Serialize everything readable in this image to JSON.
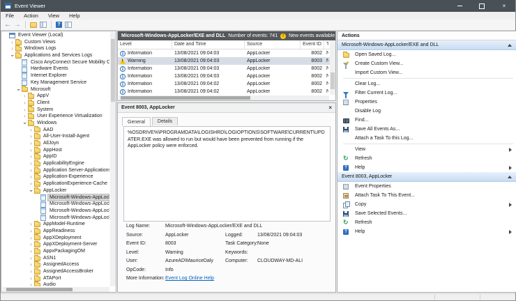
{
  "window": {
    "title": "Event Viewer"
  },
  "menu": [
    "File",
    "Action",
    "View",
    "Help"
  ],
  "toolbar": {
    "icons": [
      "back",
      "forward",
      "up-folder",
      "show-console-tree",
      "help",
      "show-action-pane"
    ]
  },
  "tree": {
    "items": [
      {
        "label": "Event Viewer (Local)",
        "level": 0,
        "chev": "none",
        "icon": "root",
        "selected": false
      },
      {
        "label": "Custom Views",
        "level": 1,
        "chev": "collapsed",
        "icon": "folder",
        "selected": false
      },
      {
        "label": "Windows Logs",
        "level": 1,
        "chev": "collapsed",
        "icon": "folder",
        "selected": false
      },
      {
        "label": "Applications and Services Logs",
        "level": 1,
        "chev": "expanded",
        "icon": "folder",
        "selected": false
      },
      {
        "label": "Cisco AnyConnect Secure Mobility Client",
        "level": 2,
        "chev": "none",
        "icon": "log",
        "selected": false
      },
      {
        "label": "Hardware Events",
        "level": 2,
        "chev": "none",
        "icon": "log",
        "selected": false
      },
      {
        "label": "Internet Explorer",
        "level": 2,
        "chev": "none",
        "icon": "log",
        "selected": false
      },
      {
        "label": "Key Management Service",
        "level": 2,
        "chev": "none",
        "icon": "log",
        "selected": false
      },
      {
        "label": "Microsoft",
        "level": 2,
        "chev": "expanded",
        "icon": "folder",
        "selected": false
      },
      {
        "label": "AppV",
        "level": 3,
        "chev": "collapsed",
        "icon": "folder",
        "selected": false
      },
      {
        "label": "Client",
        "level": 3,
        "chev": "collapsed",
        "icon": "folder",
        "selected": false
      },
      {
        "label": "System",
        "level": 3,
        "chev": "collapsed",
        "icon": "folder",
        "selected": false
      },
      {
        "label": "User Experience Virtualization",
        "level": 3,
        "chev": "collapsed",
        "icon": "folder",
        "selected": false
      },
      {
        "label": "Windows",
        "level": 3,
        "chev": "expanded",
        "icon": "folder",
        "selected": false
      },
      {
        "label": "AAD",
        "level": 4,
        "chev": "collapsed",
        "icon": "folder",
        "selected": false
      },
      {
        "label": "All-User-Install-Agent",
        "level": 4,
        "chev": "collapsed",
        "icon": "folder",
        "selected": false
      },
      {
        "label": "AllJoyn",
        "level": 4,
        "chev": "collapsed",
        "icon": "folder",
        "selected": false
      },
      {
        "label": "AppHost",
        "level": 4,
        "chev": "collapsed",
        "icon": "folder",
        "selected": false
      },
      {
        "label": "AppID",
        "level": 4,
        "chev": "collapsed",
        "icon": "folder",
        "selected": false
      },
      {
        "label": "ApplicabilityEngine",
        "level": 4,
        "chev": "collapsed",
        "icon": "folder",
        "selected": false
      },
      {
        "label": "Application Server-Applications",
        "level": 4,
        "chev": "collapsed",
        "icon": "folder",
        "selected": false
      },
      {
        "label": "Application-Experience",
        "level": 4,
        "chev": "collapsed",
        "icon": "folder",
        "selected": false
      },
      {
        "label": "ApplicationExperience-Cache",
        "level": 4,
        "chev": "collapsed",
        "icon": "folder",
        "selected": false
      },
      {
        "label": "AppLocker",
        "level": 4,
        "chev": "expanded",
        "icon": "folder",
        "selected": false
      },
      {
        "label": "Microsoft-Windows-AppLocke",
        "level": 5,
        "chev": "none",
        "icon": "log",
        "selected": true
      },
      {
        "label": "Microsoft-Windows-AppLocke",
        "level": 5,
        "chev": "none",
        "icon": "log",
        "selected": false
      },
      {
        "label": "Microsoft-Windows-AppLocke",
        "level": 5,
        "chev": "none",
        "icon": "log",
        "selected": false
      },
      {
        "label": "Microsoft-Windows-AppLocke",
        "level": 5,
        "chev": "none",
        "icon": "log",
        "selected": false
      },
      {
        "label": "AppModel-Runtime",
        "level": 4,
        "chev": "collapsed",
        "icon": "folder",
        "selected": false
      },
      {
        "label": "AppReadiness",
        "level": 4,
        "chev": "collapsed",
        "icon": "folder",
        "selected": false
      },
      {
        "label": "AppXDeployment",
        "level": 4,
        "chev": "collapsed",
        "icon": "folder",
        "selected": false
      },
      {
        "label": "AppXDeployment-Server",
        "level": 4,
        "chev": "collapsed",
        "icon": "folder",
        "selected": false
      },
      {
        "label": "AppxPackagingOM",
        "level": 4,
        "chev": "collapsed",
        "icon": "folder",
        "selected": false
      },
      {
        "label": "ASN1",
        "level": 4,
        "chev": "collapsed",
        "icon": "folder",
        "selected": false
      },
      {
        "label": "AssignedAccess",
        "level": 4,
        "chev": "collapsed",
        "icon": "folder",
        "selected": false
      },
      {
        "label": "AssignedAccessBroker",
        "level": 4,
        "chev": "collapsed",
        "icon": "folder",
        "selected": false
      },
      {
        "label": "ATAPort",
        "level": 4,
        "chev": "collapsed",
        "icon": "folder",
        "selected": false
      },
      {
        "label": "Audio",
        "level": 4,
        "chev": "collapsed",
        "icon": "folder",
        "selected": false
      }
    ]
  },
  "list": {
    "title": "Microsoft-Windows-AppLocker/EXE and DLL",
    "count_text": "Number of events: 741",
    "new_events_text": "New events available",
    "columns": [
      "Level",
      "Date and Time",
      "Source",
      "Event ID",
      "Task Category"
    ],
    "rows": [
      {
        "level": "Information",
        "icon": "info",
        "datetime": "13/08/2021 09:04:03",
        "source": "AppLocker",
        "event_id": "8002",
        "task": "N",
        "selected": false
      },
      {
        "level": "Warning",
        "icon": "warn",
        "datetime": "13/08/2021 09:04:03",
        "source": "AppLocker",
        "event_id": "8003",
        "task": "N",
        "selected": true
      },
      {
        "level": "Information",
        "icon": "info",
        "datetime": "13/08/2021 09:04:03",
        "source": "AppLocker",
        "event_id": "8002",
        "task": "N",
        "selected": false
      },
      {
        "level": "Information",
        "icon": "info",
        "datetime": "13/08/2021 09:04:03",
        "source": "AppLocker",
        "event_id": "8002",
        "task": "N",
        "selected": false
      },
      {
        "level": "Information",
        "icon": "info",
        "datetime": "13/08/2021 09:04:02",
        "source": "AppLocker",
        "event_id": "8002",
        "task": "N",
        "selected": false
      },
      {
        "level": "Information",
        "icon": "info",
        "datetime": "13/08/2021 09:04:02",
        "source": "AppLocker",
        "event_id": "8002",
        "task": "N",
        "selected": false
      }
    ]
  },
  "detail": {
    "header": "Event 8003, AppLocker",
    "tabs": [
      {
        "label": "General",
        "active": true
      },
      {
        "label": "Details",
        "active": false
      }
    ],
    "description": "%OSDRIVE%\\PROGRAMDATA\\LOGISHRD\\LOGIOPTIONS\\SOFTWARE\\CURRENT\\UPDATER.EXE was allowed to run but would have been prevented from running if the AppLocker policy were enforced.",
    "fields": [
      {
        "l1": "Log Name:",
        "v1": "Microsoft-Windows-AppLocker/EXE and DLL",
        "l2": "",
        "v2": "",
        "link": false
      },
      {
        "l1": "Source:",
        "v1": "AppLocker",
        "l2": "Logged:",
        "v2": "13/08/2021 09:04:03",
        "link": false
      },
      {
        "l1": "Event ID:",
        "v1": "8003",
        "l2": "Task Category:",
        "v2": "None",
        "link": false
      },
      {
        "l1": "Level:",
        "v1": "Warning",
        "l2": "Keywords:",
        "v2": "",
        "link": false
      },
      {
        "l1": "User:",
        "v1": "AzureAD\\MauriceDaly",
        "l2": "Computer:",
        "v2": "CLOUDWAY-MD-ALI",
        "link": false
      },
      {
        "l1": "OpCode:",
        "v1": "Info",
        "l2": "",
        "v2": "",
        "link": false
      },
      {
        "l1": "More Information:",
        "v1": "Event Log Online Help",
        "l2": "",
        "v2": "",
        "link": true
      }
    ]
  },
  "actions": {
    "title": "Actions",
    "sections": [
      {
        "header": "Microsoft-Windows-AppLocker/EXE and DLL",
        "items": [
          {
            "label": "Open Saved Log...",
            "icon": "folder",
            "arrow": false,
            "sep_before": false
          },
          {
            "label": "Create Custom View...",
            "icon": "funnel-gray",
            "arrow": false,
            "sep_before": false
          },
          {
            "label": "Import Custom View...",
            "icon": "none",
            "arrow": false,
            "sep_before": false
          },
          {
            "label": "Clear Log...",
            "icon": "none",
            "arrow": false,
            "sep_before": true
          },
          {
            "label": "Filter Current Log...",
            "icon": "funnel-blue",
            "arrow": false,
            "sep_before": false
          },
          {
            "label": "Properties",
            "icon": "props",
            "arrow": false,
            "sep_before": false
          },
          {
            "label": "Disable Log",
            "icon": "none",
            "arrow": false,
            "sep_before": false
          },
          {
            "label": "Find...",
            "icon": "find",
            "arrow": false,
            "sep_before": false
          },
          {
            "label": "Save All Events As...",
            "icon": "save",
            "arrow": false,
            "sep_before": false
          },
          {
            "label": "Attach a Task To this Log...",
            "icon": "none",
            "arrow": false,
            "sep_before": false
          },
          {
            "label": "View",
            "icon": "none",
            "arrow": true,
            "sep_before": true
          },
          {
            "label": "Refresh",
            "icon": "refresh",
            "arrow": false,
            "sep_before": false
          },
          {
            "label": "Help",
            "icon": "help",
            "arrow": true,
            "sep_before": false
          }
        ]
      },
      {
        "header": "Event 8003, AppLocker",
        "items": [
          {
            "label": "Event Properties",
            "icon": "props",
            "arrow": false,
            "sep_before": false
          },
          {
            "label": "Attach Task To This Event...",
            "icon": "task",
            "arrow": false,
            "sep_before": false
          },
          {
            "label": "Copy",
            "icon": "copy",
            "arrow": true,
            "sep_before": false
          },
          {
            "label": "Save Selected Events...",
            "icon": "save",
            "arrow": false,
            "sep_before": false
          },
          {
            "label": "Refresh",
            "icon": "refresh",
            "arrow": false,
            "sep_before": false
          },
          {
            "label": "Help",
            "icon": "help",
            "arrow": true,
            "sep_before": false
          }
        ]
      }
    ]
  }
}
